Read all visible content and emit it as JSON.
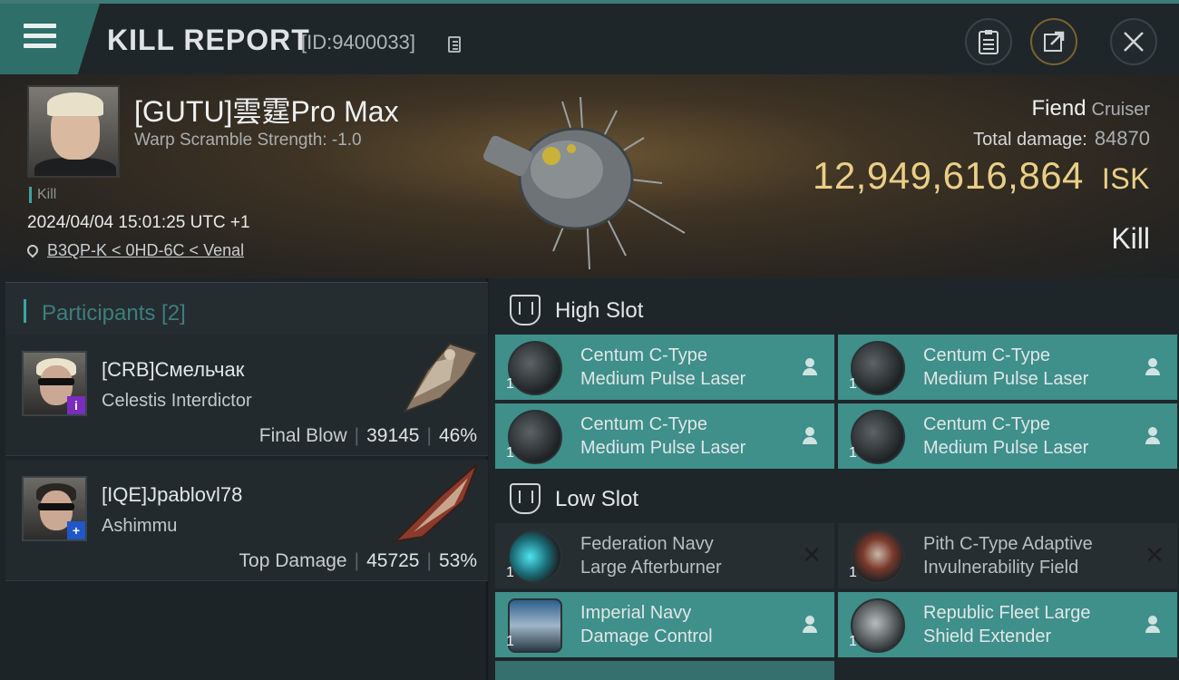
{
  "header": {
    "title": "KILL REPORT",
    "report_id": "[ID:9400033]",
    "menu_icon": "hamburger-menu-icon",
    "buttons": [
      "clipboard-icon",
      "share-icon",
      "close-icon"
    ]
  },
  "victim": {
    "name": "[GUTU]雲霆Pro Max",
    "warp_scramble": "Warp Scramble Strength: -1.0",
    "tag": "Kill",
    "datetime": "2024/04/04 15:01:25 UTC +1",
    "location": "B3QP-K < 0HD-6C < Venal",
    "ship_name": "Fiend",
    "ship_class": "Cruiser",
    "total_damage_label": "Total damage:",
    "total_damage": "84870",
    "isk_value": "12,949,616,864",
    "isk_unit": "ISK",
    "result": "Kill"
  },
  "participants": {
    "header": "Participants [2]",
    "items": [
      {
        "name": "[CRB]Смельчак",
        "ship": "Celestis Interdictor",
        "role": "Final Blow",
        "damage": "39145",
        "percent": "46%",
        "badge_color": "#7a2cbf",
        "badge": "i"
      },
      {
        "name": "[IQE]Jpablovl78",
        "ship": "Ashimmu",
        "role": "Top Damage",
        "damage": "45725",
        "percent": "53%",
        "badge_color": "#1f57c8",
        "badge": "+"
      }
    ]
  },
  "slots": {
    "high": {
      "label": "High Slot",
      "modules": [
        {
          "line1": "Centum C-Type",
          "line2": "Medium Pulse Laser",
          "qty": "1",
          "state": "dropped"
        },
        {
          "line1": "Centum C-Type",
          "line2": "Medium Pulse Laser",
          "qty": "1",
          "state": "dropped"
        },
        {
          "line1": "Centum C-Type",
          "line2": "Medium Pulse Laser",
          "qty": "1",
          "state": "dropped"
        },
        {
          "line1": "Centum C-Type",
          "line2": "Medium Pulse Laser",
          "qty": "1",
          "state": "dropped"
        }
      ]
    },
    "low": {
      "label": "Low Slot",
      "modules": [
        {
          "line1": "Federation Navy",
          "line2": "Large Afterburner",
          "qty": "1",
          "state": "destroyed"
        },
        {
          "line1": "Pith C-Type Adaptive",
          "line2": "Invulnerability Field",
          "qty": "1",
          "state": "destroyed"
        },
        {
          "line1": "Imperial Navy",
          "line2": "Damage Control",
          "qty": "1",
          "state": "dropped"
        },
        {
          "line1": "Republic Fleet Large",
          "line2": "Shield Extender",
          "qty": "1",
          "state": "dropped"
        }
      ]
    }
  },
  "colors": {
    "accent": "#3f8f8b",
    "isk_gold": "#e9cf86",
    "panel": "#1f2629"
  }
}
